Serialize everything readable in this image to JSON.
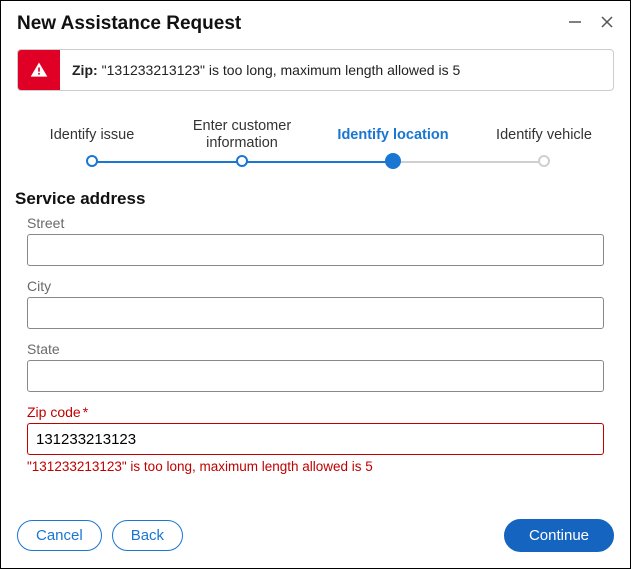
{
  "title": "New Assistance Request",
  "alert": {
    "field_label": "Zip:",
    "message": "\"131233213123\" is too long, maximum length allowed is 5"
  },
  "stepper": {
    "steps": [
      {
        "label": "Identify issue"
      },
      {
        "label_line1": "Enter customer",
        "label_line2": "information"
      },
      {
        "label": "Identify location",
        "active": true
      },
      {
        "label": "Identify vehicle"
      }
    ]
  },
  "section_title": "Service address",
  "fields": {
    "street": {
      "label": "Street",
      "value": ""
    },
    "city": {
      "label": "City",
      "value": ""
    },
    "state": {
      "label": "State",
      "value": ""
    },
    "zip": {
      "label": "Zip code",
      "required": true,
      "value": "131233213123",
      "error": "\"131233213123\" is too long, maximum length allowed is 5"
    }
  },
  "footer": {
    "cancel": "Cancel",
    "back": "Back",
    "continue": "Continue"
  }
}
